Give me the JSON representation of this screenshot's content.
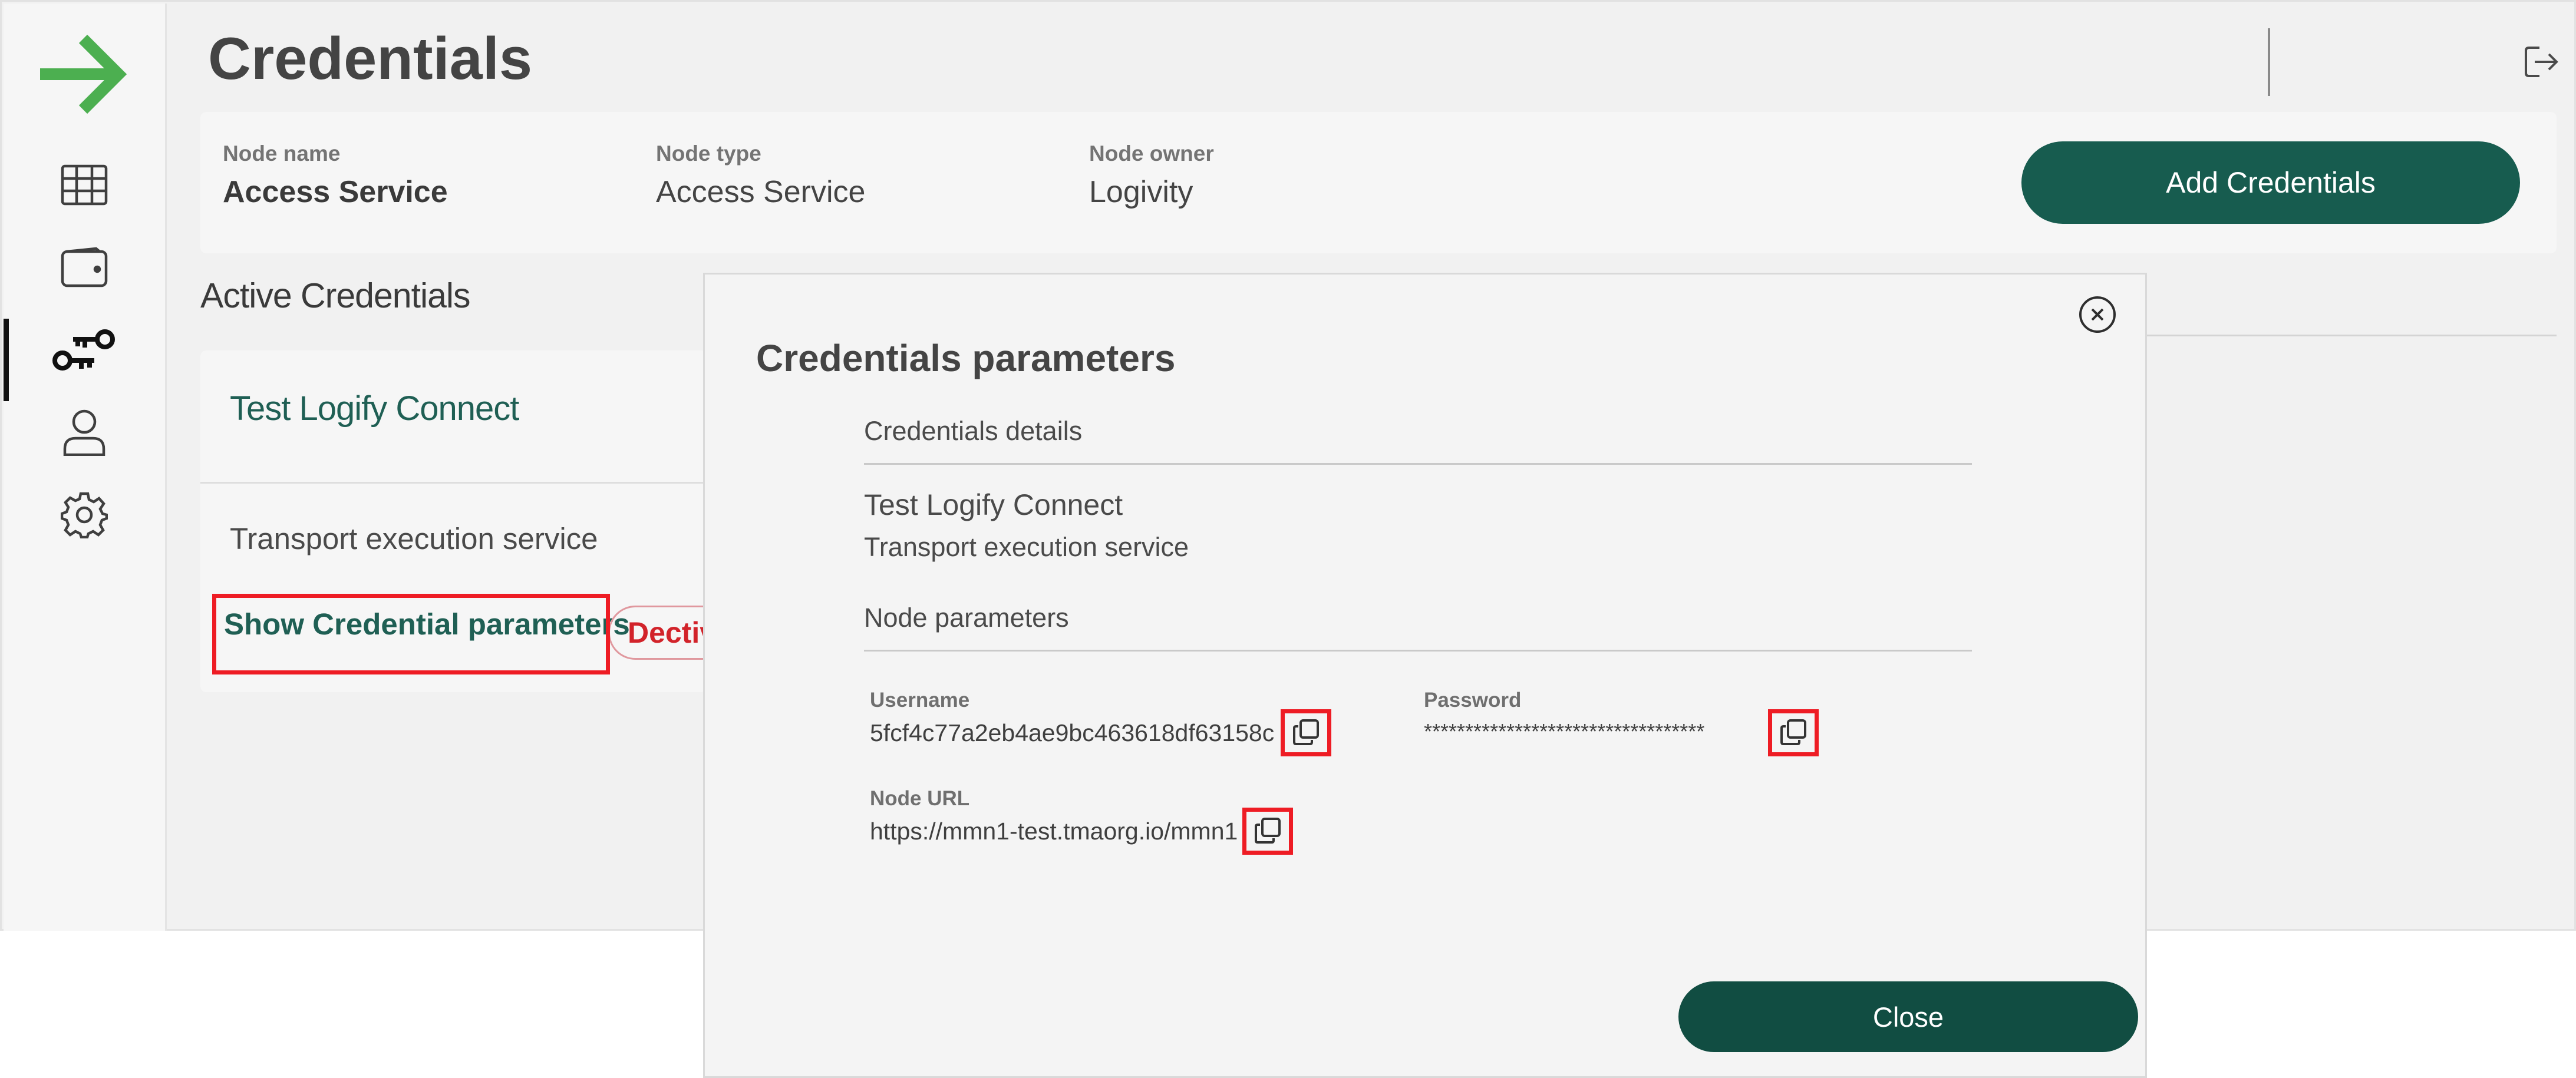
{
  "header": {
    "title": "Credentials"
  },
  "node_info": {
    "name_label": "Node name",
    "name_value": "Access Service",
    "type_label": "Node type",
    "type_value": "Access Service",
    "owner_label": "Node owner",
    "owner_value": "Logivity",
    "add_button": "Add Credentials"
  },
  "sidebar": {
    "items": [
      {
        "icon": "grid-icon"
      },
      {
        "icon": "wallet-icon"
      },
      {
        "icon": "keys-icon",
        "active": true
      },
      {
        "icon": "user-icon"
      },
      {
        "icon": "gear-icon"
      }
    ]
  },
  "active_section": {
    "title": "Active Credentials",
    "card": {
      "title": "Test Logify Connect",
      "service": "Transport execution service",
      "show_params": "Show Credential parameters",
      "deactivate": "Dectiv"
    }
  },
  "modal": {
    "title": "Credentials parameters",
    "details_heading": "Credentials details",
    "cred_name": "Test Logify Connect",
    "cred_service": "Transport execution service",
    "node_params_heading": "Node parameters",
    "username_label": "Username",
    "username_value": "5fcf4c77a2eb4ae9bc463618df63158c",
    "password_label": "Password",
    "password_value": "**********************************",
    "url_label": "Node URL",
    "url_value": "https://mmn1-test.tmaorg.io/mmn1",
    "close_button": "Close"
  },
  "colors": {
    "brand_green": "#175c4f",
    "logo_green": "#4caf50",
    "highlight_red": "#ee1c24",
    "danger_red": "#d2232a"
  }
}
